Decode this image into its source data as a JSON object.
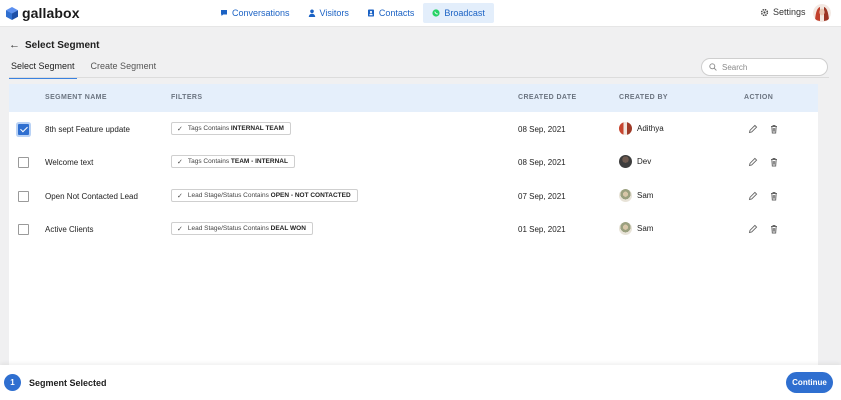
{
  "app": {
    "logo_text": "gallabox"
  },
  "nav": {
    "items": [
      {
        "label": "Conversations",
        "icon": "chat-icon"
      },
      {
        "label": "Visitors",
        "icon": "person-icon"
      },
      {
        "label": "Contacts",
        "icon": "contact-book-icon"
      },
      {
        "label": "Broadcast",
        "icon": "whatsapp-icon",
        "active": true
      }
    ],
    "settings_label": "Settings"
  },
  "page": {
    "title": "Select Segment",
    "tabs": [
      {
        "label": "Select Segment",
        "active": true
      },
      {
        "label": "Create Segment",
        "active": false
      }
    ],
    "search_placeholder": "Search"
  },
  "table": {
    "columns": {
      "name": "SEGMENT NAME",
      "filters": "FILTERS",
      "created_date": "CREATED DATE",
      "created_by": "CREATED BY",
      "action": "ACTION"
    },
    "rows": [
      {
        "checked": true,
        "name": "8th sept Feature update",
        "filter_prefix": "Tags Contains",
        "filter_value": "INTERNAL TEAM",
        "date": "08 Sep, 2021",
        "creator": "Adithya"
      },
      {
        "checked": false,
        "name": "Welcome text",
        "filter_prefix": "Tags Contains",
        "filter_value": "TEAM - INTERNAL",
        "date": "08 Sep, 2021",
        "creator": "Dev"
      },
      {
        "checked": false,
        "name": "Open Not Contacted Lead",
        "filter_prefix": "Lead Stage/Status Contains",
        "filter_value": "OPEN - NOT CONTACTED",
        "date": "07 Sep, 2021",
        "creator": "Sam"
      },
      {
        "checked": false,
        "name": "Active Clients",
        "filter_prefix": "Lead Stage/Status Contains",
        "filter_value": "DEAL WON",
        "date": "01 Sep, 2021",
        "creator": "Sam"
      }
    ]
  },
  "footer": {
    "selected_count": "1",
    "selected_label": "Segment Selected",
    "continue_label": "Continue"
  },
  "colors": {
    "primary": "#2f6fd0",
    "nav_text": "#1b62c4",
    "header_bg": "#e5effb",
    "whatsapp": "#25d366"
  }
}
